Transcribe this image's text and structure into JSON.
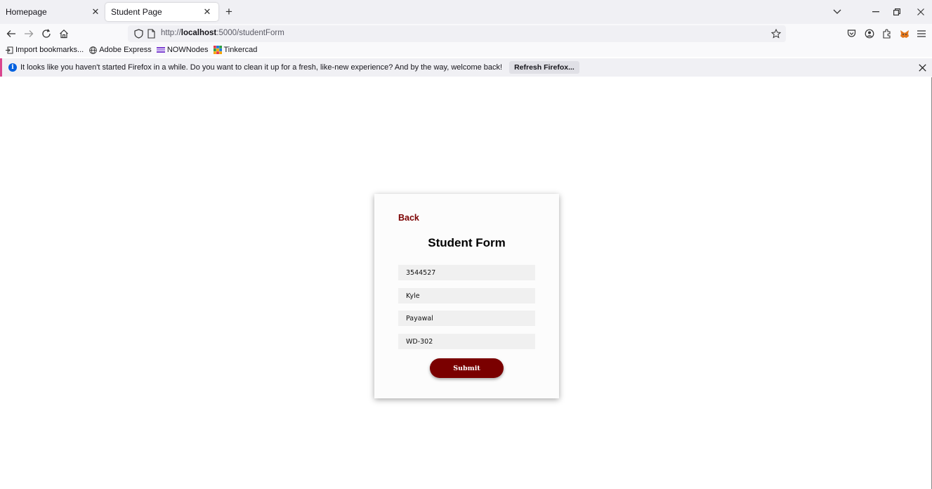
{
  "tabs": [
    {
      "label": "Homepage",
      "active": false
    },
    {
      "label": "Student Page",
      "active": true
    }
  ],
  "nav": {
    "url_prefix": "http://",
    "url_host": "localhost",
    "url_rest": ":5000/studentForm"
  },
  "bookmarks": [
    {
      "label": "Import bookmarks...",
      "icon": "import-icon"
    },
    {
      "label": "Adobe Express",
      "icon": "globe-icon"
    },
    {
      "label": "NOWNodes",
      "icon": "nownodes-icon"
    },
    {
      "label": "Tinkercad",
      "icon": "tinkercad-icon"
    }
  ],
  "notification": {
    "message": "It looks like you haven't started Firefox in a while. Do you want to clean it up for a fresh, like-new experience? And by the way, welcome back!",
    "button_label": "Refresh Firefox..."
  },
  "form": {
    "back_label": "Back",
    "title": "Student Form",
    "fields": [
      {
        "value": "3544527"
      },
      {
        "value": "Kyle"
      },
      {
        "value": "Payawal"
      },
      {
        "value": "WD-302"
      }
    ],
    "submit_label": "Submit"
  },
  "colors": {
    "accent": "#7a0000",
    "notify_border": "#d9468f",
    "info_blue": "#0060df"
  }
}
